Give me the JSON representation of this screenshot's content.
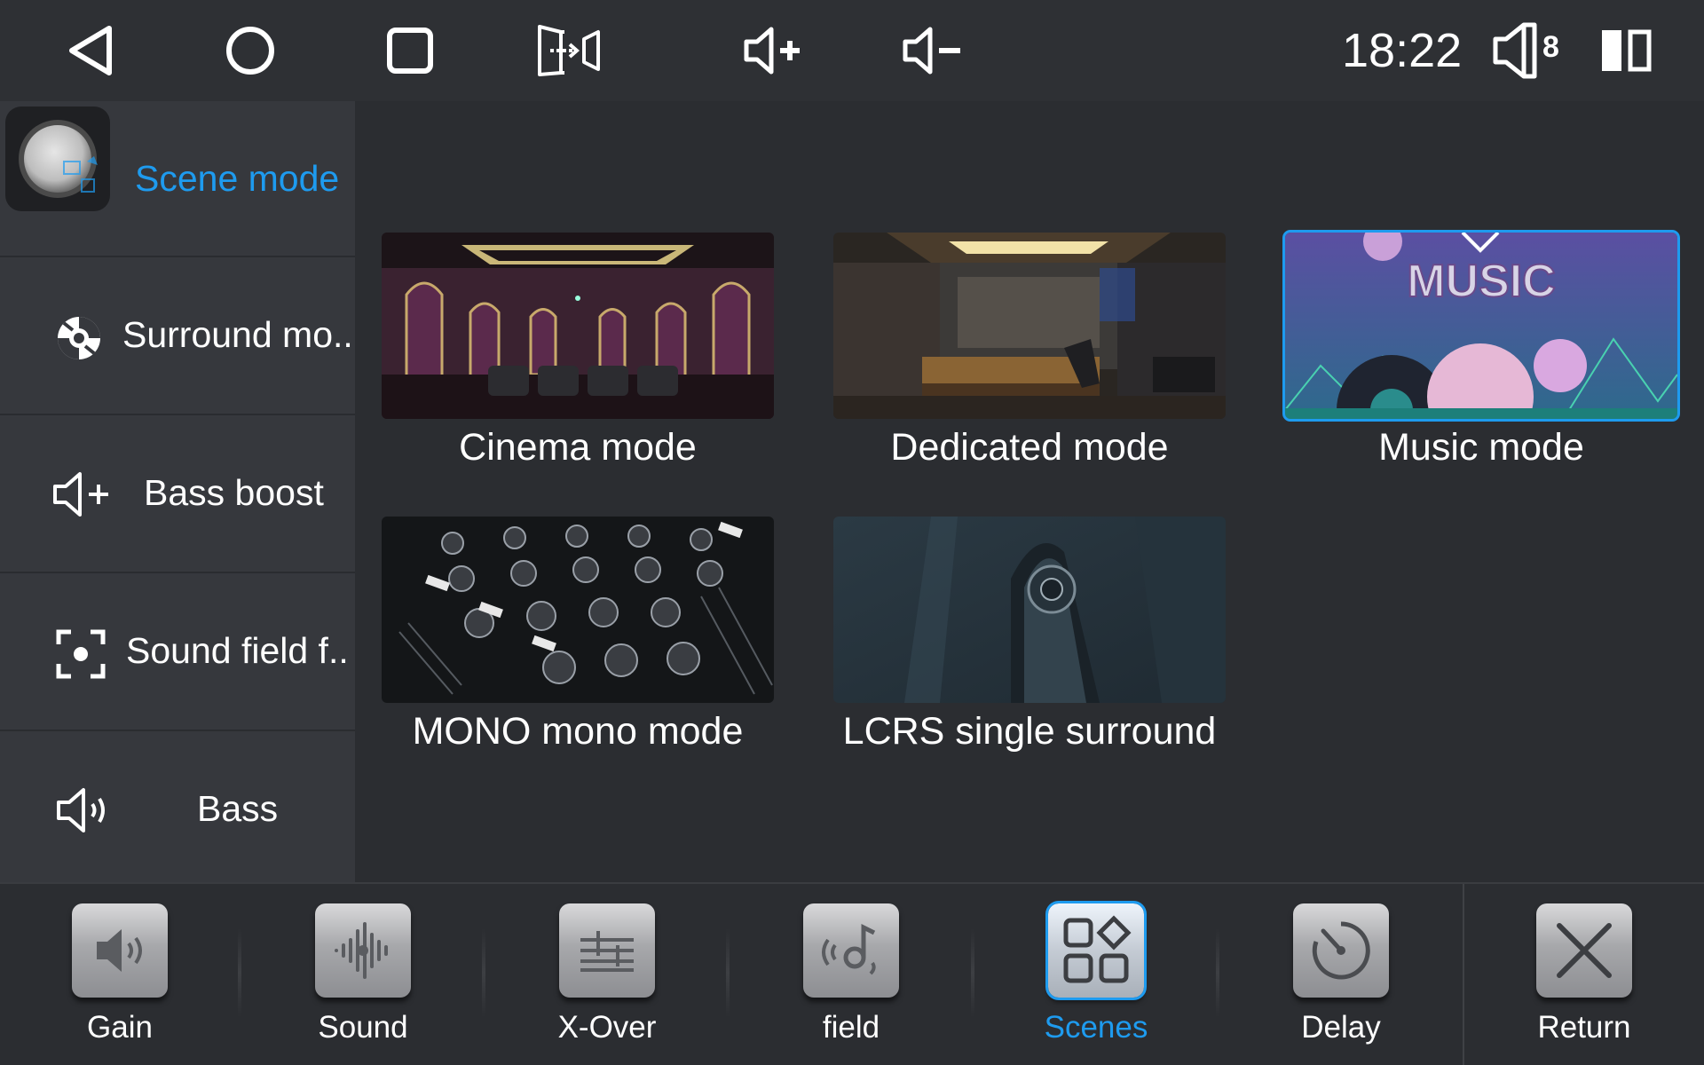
{
  "status_bar": {
    "time": "18:22",
    "volume_level": "8",
    "icons": [
      "back-icon",
      "home-icon",
      "recents-icon",
      "exit-app-icon",
      "volume-up-icon",
      "volume-down-icon",
      "speaker-icon",
      "split-screen-icon"
    ]
  },
  "sidebar": {
    "items": [
      {
        "label": "Scene mode",
        "icon": "scene-knob-icon",
        "active": true
      },
      {
        "label": "Surround mo..",
        "icon": "surround-icon",
        "active": false
      },
      {
        "label": "Bass boost",
        "icon": "volume-plus-icon",
        "active": false
      },
      {
        "label": "Sound field f..",
        "icon": "focus-target-icon",
        "active": false
      },
      {
        "label": "Bass",
        "icon": "speaker-wave-icon",
        "active": false
      }
    ]
  },
  "scenes": [
    {
      "label": "Cinema mode",
      "selected": false,
      "thumb": "cinema-room"
    },
    {
      "label": "Dedicated mode",
      "selected": false,
      "thumb": "studio-room"
    },
    {
      "label": "Music mode",
      "selected": true,
      "thumb": "music-poster",
      "thumb_text": "MUSIC"
    },
    {
      "label": "MONO mono mode",
      "selected": false,
      "thumb": "mixer-console"
    },
    {
      "label": "LCRS single surround",
      "selected": false,
      "thumb": "speaker-closeup"
    }
  ],
  "bottom_tabs": [
    {
      "label": "Gain",
      "icon": "gain-speaker-icon",
      "active": false
    },
    {
      "label": "Sound",
      "icon": "sound-wave-icon",
      "active": false
    },
    {
      "label": "X-Over",
      "icon": "crossover-icon",
      "active": false
    },
    {
      "label": "field",
      "icon": "sound-field-icon",
      "active": false
    },
    {
      "label": "Scenes",
      "icon": "scenes-grid-icon",
      "active": true
    },
    {
      "label": "Delay",
      "icon": "delay-dial-icon",
      "active": false
    },
    {
      "label": "Return",
      "icon": "close-x-icon",
      "active": false
    }
  ],
  "colors": {
    "accent": "#1e9bef",
    "background": "#2b2d31",
    "sidebar": "#36383d",
    "statusbar": "#2e3034"
  }
}
